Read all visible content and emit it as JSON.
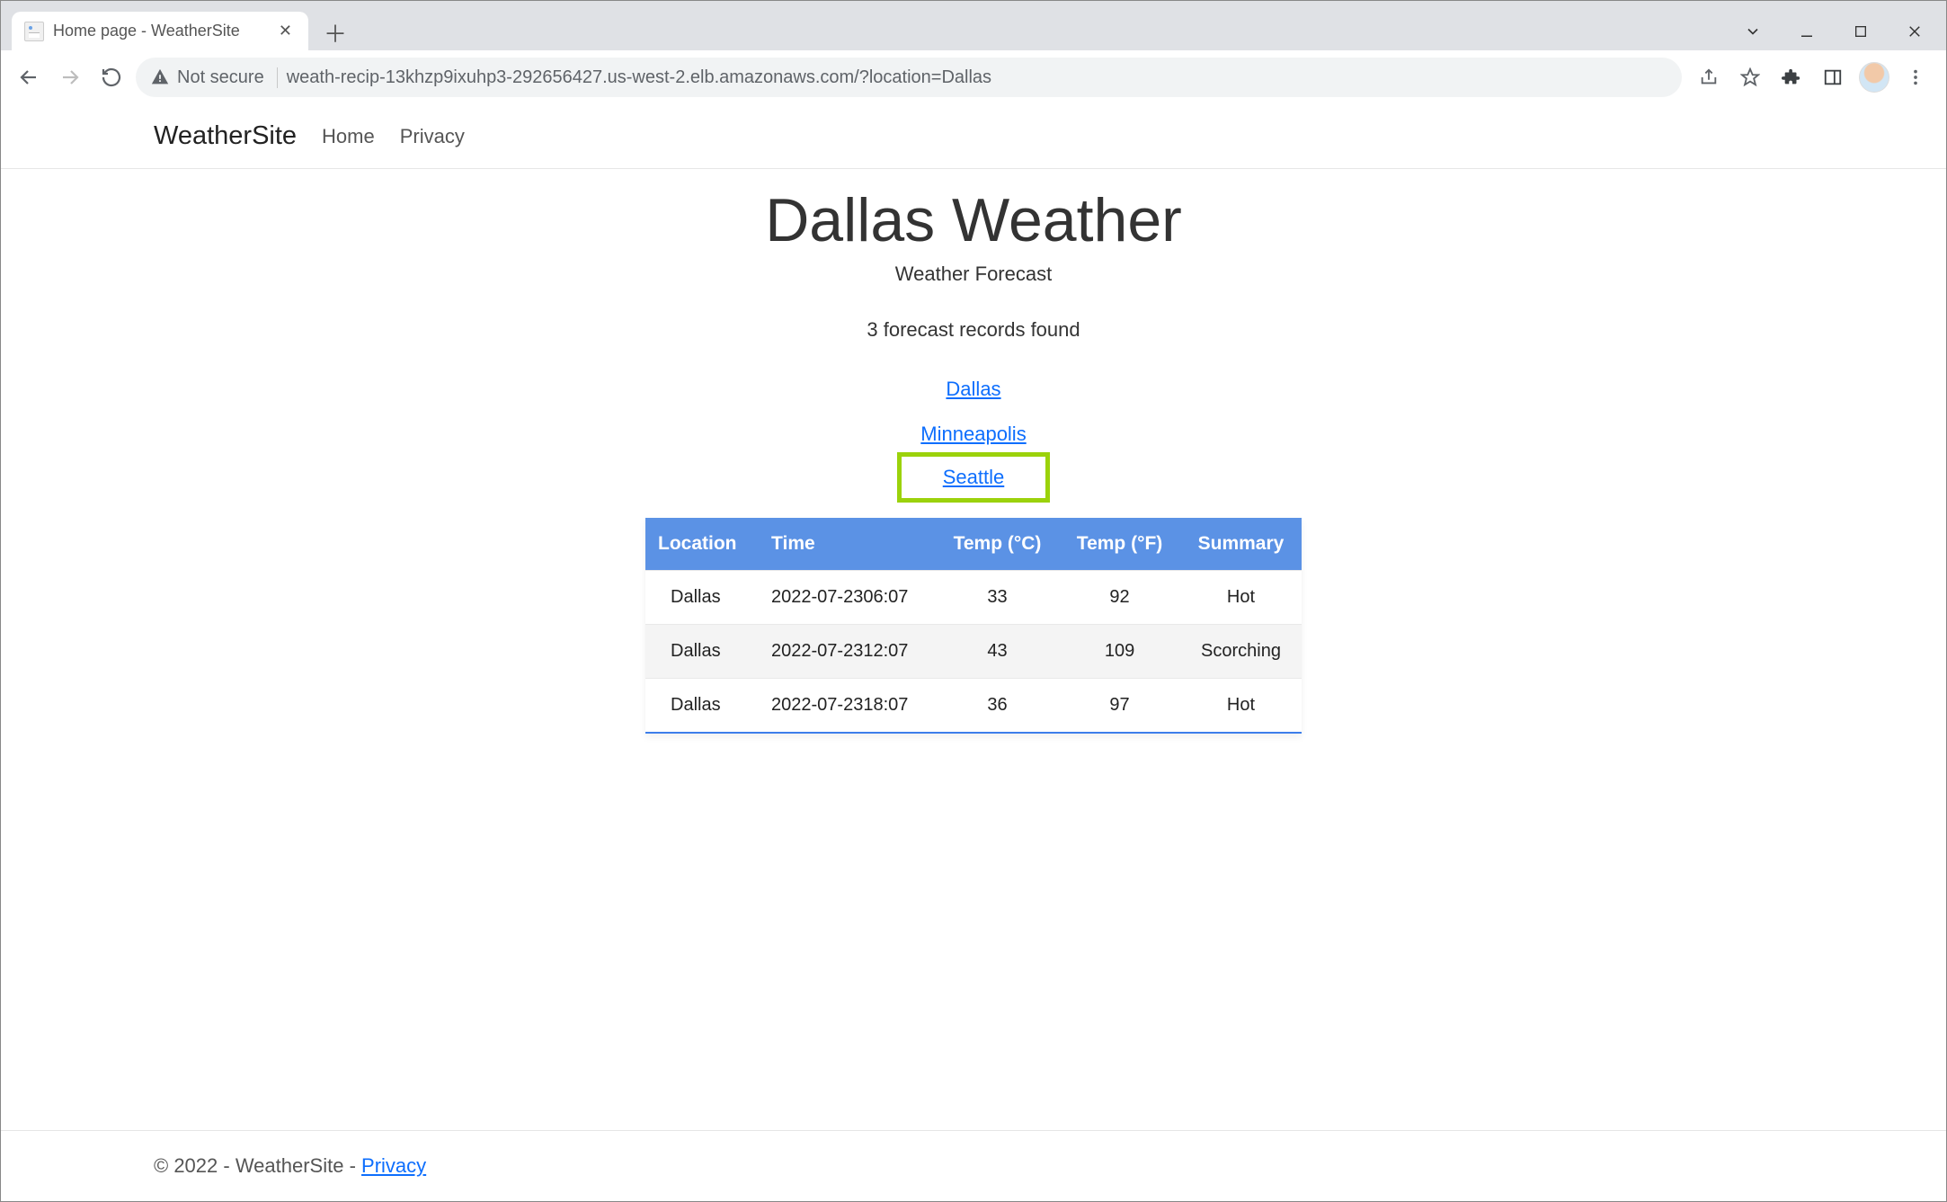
{
  "browser": {
    "tab_title": "Home page - WeatherSite",
    "not_secure_label": "Not secure",
    "url": "weath-recip-13khzp9ixuhp3-292656427.us-west-2.elb.amazonaws.com/?location=Dallas"
  },
  "nav": {
    "brand": "WeatherSite",
    "home": "Home",
    "privacy": "Privacy"
  },
  "main": {
    "title": "Dallas Weather",
    "subtitle": "Weather Forecast",
    "records_found": "3 forecast records found",
    "city_links": [
      "Dallas",
      "Minneapolis",
      "Seattle"
    ],
    "highlighted_city_index": 2
  },
  "table": {
    "headers": [
      "Location",
      "Time",
      "Temp (°C)",
      "Temp (°F)",
      "Summary"
    ],
    "rows": [
      {
        "location": "Dallas",
        "time": "2022-07-2306:07",
        "tempC": "33",
        "tempF": "92",
        "summary": "Hot"
      },
      {
        "location": "Dallas",
        "time": "2022-07-2312:07",
        "tempC": "43",
        "tempF": "109",
        "summary": "Scorching"
      },
      {
        "location": "Dallas",
        "time": "2022-07-2318:07",
        "tempC": "36",
        "tempF": "97",
        "summary": "Hot"
      }
    ]
  },
  "footer": {
    "text": "© 2022 - WeatherSite - ",
    "privacy": "Privacy"
  }
}
